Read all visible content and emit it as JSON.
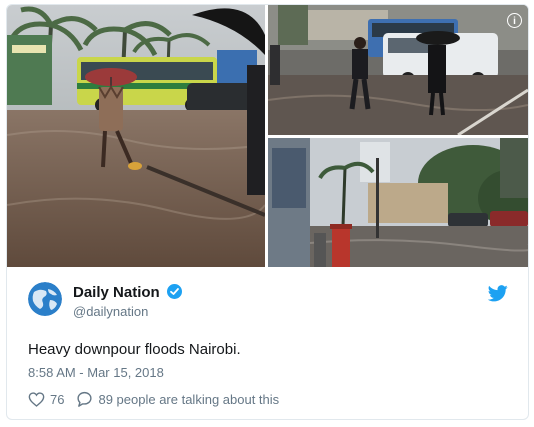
{
  "tweet": {
    "author_name": "Daily Nation",
    "author_handle": "@dailynation",
    "text": "Heavy downpour floods Nairobi.",
    "timestamp": "8:58 AM - Mar 15, 2018",
    "likes": "76",
    "talking": "89 people are talking about this"
  },
  "icons": {
    "verified": "verified-badge-icon",
    "platform": "bird-icon",
    "like": "heart-icon",
    "reply": "speech-bubble-icon",
    "info": "info-icon"
  },
  "colors": {
    "accent": "#1da1f2",
    "secondary_text": "#657786",
    "primary_text": "#14171a",
    "border": "#e1e8ed"
  }
}
